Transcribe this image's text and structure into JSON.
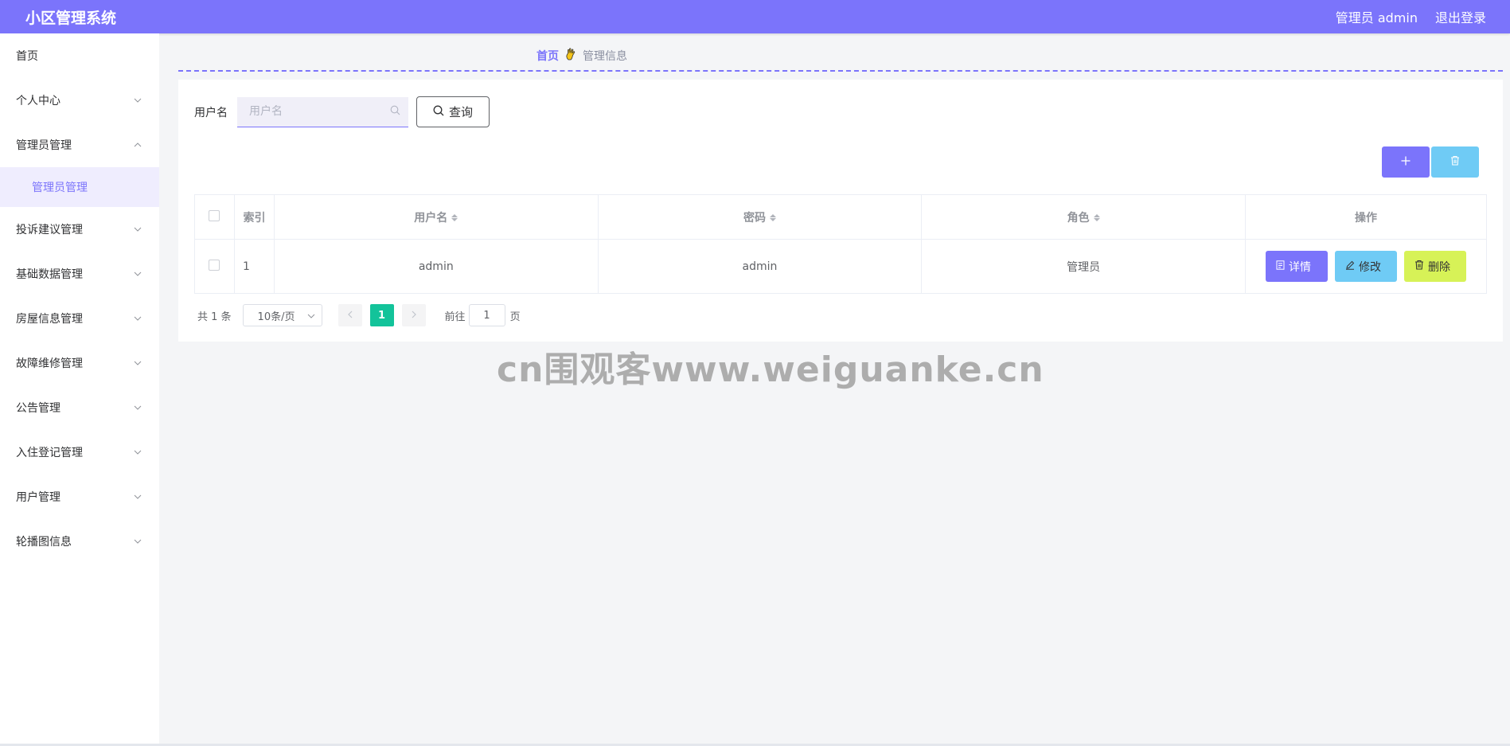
{
  "header": {
    "app_title": "小区管理系统",
    "user_label": "管理员 admin",
    "logout_label": "退出登录"
  },
  "sidebar": {
    "items": [
      {
        "label": "首页",
        "has_arrow": false
      },
      {
        "label": "个人中心",
        "has_arrow": true,
        "expanded": false
      },
      {
        "label": "管理员管理",
        "has_arrow": true,
        "expanded": true,
        "children": [
          {
            "label": "管理员管理",
            "active": true
          }
        ]
      },
      {
        "label": "投诉建议管理",
        "has_arrow": true,
        "expanded": false
      },
      {
        "label": "基础数据管理",
        "has_arrow": true,
        "expanded": false
      },
      {
        "label": "房屋信息管理",
        "has_arrow": true,
        "expanded": false
      },
      {
        "label": "故障维修管理",
        "has_arrow": true,
        "expanded": false
      },
      {
        "label": "公告管理",
        "has_arrow": true,
        "expanded": false
      },
      {
        "label": "入住登记管理",
        "has_arrow": true,
        "expanded": false
      },
      {
        "label": "用户管理",
        "has_arrow": true,
        "expanded": false
      },
      {
        "label": "轮播图信息",
        "has_arrow": true,
        "expanded": false
      }
    ]
  },
  "breadcrumb": {
    "home": "首页",
    "icon": "hand-icon",
    "current": "管理信息"
  },
  "search": {
    "label": "用户名",
    "placeholder": "用户名",
    "value": "",
    "button_label": "查询"
  },
  "toolbar": {
    "add_icon": "plus-icon",
    "delete_icon": "trash-icon"
  },
  "table": {
    "columns": [
      "索引",
      "用户名",
      "密码",
      "角色",
      "操作"
    ],
    "rows": [
      {
        "index": "1",
        "username": "admin",
        "password": "admin",
        "role": "管理员"
      }
    ],
    "row_actions": {
      "detail": "详情",
      "edit": "修改",
      "delete": "删除"
    }
  },
  "pagination": {
    "total_label": "共 1 条",
    "page_size": "10条/页",
    "current_page": "1",
    "goto_prefix": "前往",
    "goto_value": "1",
    "goto_suffix": "页"
  },
  "watermark": "cn围观客www.weiguanke.cn",
  "colors": {
    "primary": "#7b74fb",
    "info": "#6fcbf5",
    "warning": "#d7f257",
    "success": "#13c39a"
  }
}
